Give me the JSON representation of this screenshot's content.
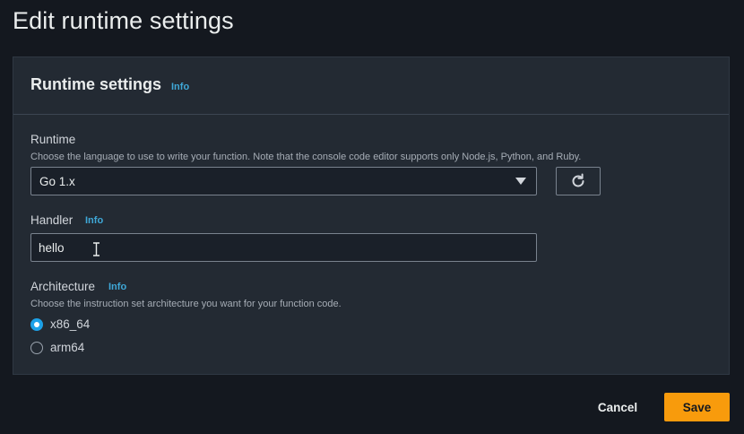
{
  "page": {
    "title": "Edit runtime settings"
  },
  "panel": {
    "title": "Runtime settings",
    "info_label": "Info"
  },
  "runtime": {
    "label": "Runtime",
    "description": "Choose the language to use to write your function. Note that the console code editor supports only Node.js, Python, and Ruby.",
    "selected": "Go 1.x",
    "refresh_icon": "refresh-icon"
  },
  "handler": {
    "label": "Handler",
    "info_label": "Info",
    "value": "hello"
  },
  "architecture": {
    "label": "Architecture",
    "info_label": "Info",
    "description": "Choose the instruction set architecture you want for your function code.",
    "options": [
      {
        "label": "x86_64",
        "selected": true
      },
      {
        "label": "arm64",
        "selected": false
      }
    ]
  },
  "footer": {
    "cancel_label": "Cancel",
    "save_label": "Save"
  },
  "colors": {
    "accent": "#1da1e8",
    "primary_button": "#f89b0c",
    "info_link": "#3fa8d8"
  }
}
